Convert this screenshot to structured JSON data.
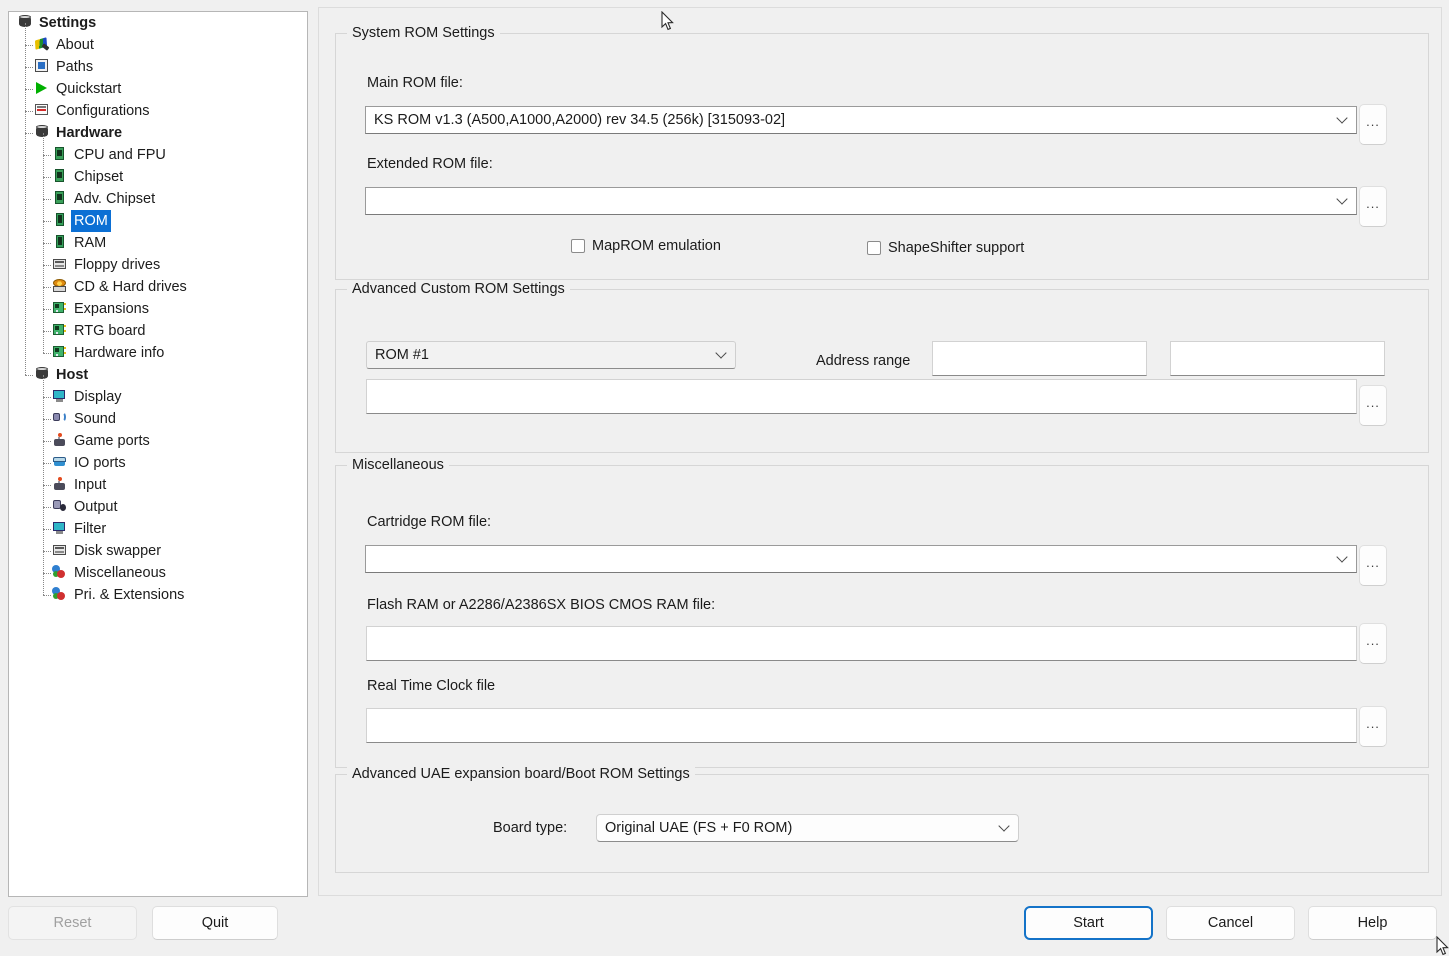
{
  "window": {
    "bg_color": "#f0f0f0",
    "accent_color": "#0b6fd4",
    "focus_color": "#1473c8"
  },
  "sidebar": {
    "items": [
      {
        "label": "Settings",
        "icon": "stack-icon",
        "depth": 0,
        "bold": true,
        "selected": false
      },
      {
        "label": "About",
        "icon": "pencil-icon",
        "depth": 1,
        "bold": false,
        "selected": false
      },
      {
        "label": "Paths",
        "icon": "paths-icon",
        "depth": 1,
        "bold": false,
        "selected": false
      },
      {
        "label": "Quickstart",
        "icon": "play-icon",
        "depth": 1,
        "bold": false,
        "selected": false
      },
      {
        "label": "Configurations",
        "icon": "configurations-icon",
        "depth": 1,
        "bold": false,
        "selected": false
      },
      {
        "label": "Hardware",
        "icon": "stack-icon",
        "depth": 1,
        "bold": true,
        "selected": false
      },
      {
        "label": "CPU and FPU",
        "icon": "chip-icon",
        "depth": 2,
        "bold": false,
        "selected": false
      },
      {
        "label": "Chipset",
        "icon": "chip-icon",
        "depth": 2,
        "bold": false,
        "selected": false
      },
      {
        "label": "Adv. Chipset",
        "icon": "chip-icon",
        "depth": 2,
        "bold": false,
        "selected": false
      },
      {
        "label": "ROM",
        "icon": "ram-icon",
        "depth": 2,
        "bold": false,
        "selected": true
      },
      {
        "label": "RAM",
        "icon": "ram-icon",
        "depth": 2,
        "bold": false,
        "selected": false
      },
      {
        "label": "Floppy drives",
        "icon": "floppy-icon",
        "depth": 2,
        "bold": false,
        "selected": false
      },
      {
        "label": "CD & Hard drives",
        "icon": "cd-icon",
        "depth": 2,
        "bold": false,
        "selected": false
      },
      {
        "label": "Expansions",
        "icon": "board-icon",
        "depth": 2,
        "bold": false,
        "selected": false
      },
      {
        "label": "RTG board",
        "icon": "board-icon",
        "depth": 2,
        "bold": false,
        "selected": false
      },
      {
        "label": "Hardware info",
        "icon": "board-icon",
        "depth": 2,
        "bold": false,
        "selected": false
      },
      {
        "label": "Host",
        "icon": "stack-icon",
        "depth": 1,
        "bold": true,
        "selected": false
      },
      {
        "label": "Display",
        "icon": "display-icon",
        "depth": 2,
        "bold": false,
        "selected": false
      },
      {
        "label": "Sound",
        "icon": "sound-icon",
        "depth": 2,
        "bold": false,
        "selected": false
      },
      {
        "label": "Game ports",
        "icon": "joystick-icon",
        "depth": 2,
        "bold": false,
        "selected": false
      },
      {
        "label": "IO ports",
        "icon": "io-icon",
        "depth": 2,
        "bold": false,
        "selected": false
      },
      {
        "label": "Input",
        "icon": "joystick-icon",
        "depth": 2,
        "bold": false,
        "selected": false
      },
      {
        "label": "Output",
        "icon": "output-icon",
        "depth": 2,
        "bold": false,
        "selected": false
      },
      {
        "label": "Filter",
        "icon": "display-icon",
        "depth": 2,
        "bold": false,
        "selected": false
      },
      {
        "label": "Disk swapper",
        "icon": "floppy-icon",
        "depth": 2,
        "bold": false,
        "selected": false
      },
      {
        "label": "Miscellaneous",
        "icon": "misc-icon",
        "depth": 2,
        "bold": false,
        "selected": false
      },
      {
        "label": "Pri. & Extensions",
        "icon": "misc-icon",
        "depth": 2,
        "bold": false,
        "selected": false
      }
    ]
  },
  "system_rom": {
    "group_title": "System ROM Settings",
    "main_rom_label": "Main ROM file:",
    "main_rom_value": "KS ROM v1.3 (A500,A1000,A2000) rev 34.5 (256k) [315093-02]",
    "extended_rom_label": "Extended ROM file:",
    "extended_rom_value": "",
    "browse_label": "...",
    "maprom_label": "MapROM emulation",
    "maprom_checked": false,
    "shapeshifter_label": "ShapeShifter support",
    "shapeshifter_checked": false
  },
  "advanced_custom_rom": {
    "group_title": "Advanced Custom ROM Settings",
    "rom_select_value": "ROM #1",
    "address_range_label": "Address range",
    "address_start_value": "",
    "address_end_value": "",
    "rom_path_value": "",
    "browse_label": "..."
  },
  "miscellaneous": {
    "group_title": "Miscellaneous",
    "cartridge_label": "Cartridge ROM file:",
    "cartridge_value": "",
    "flash_label": "Flash RAM or A2286/A2386SX BIOS CMOS RAM file:",
    "flash_value": "",
    "rtc_label": "Real Time Clock file",
    "rtc_value": "",
    "browse_label": "..."
  },
  "uae_expansion": {
    "group_title": "Advanced UAE expansion board/Boot ROM Settings",
    "board_type_label": "Board type:",
    "board_type_value": "Original UAE (FS + F0 ROM)"
  },
  "footer": {
    "reset_label": "Reset",
    "reset_disabled": true,
    "quit_label": "Quit",
    "start_label": "Start",
    "cancel_label": "Cancel",
    "help_label": "Help"
  }
}
